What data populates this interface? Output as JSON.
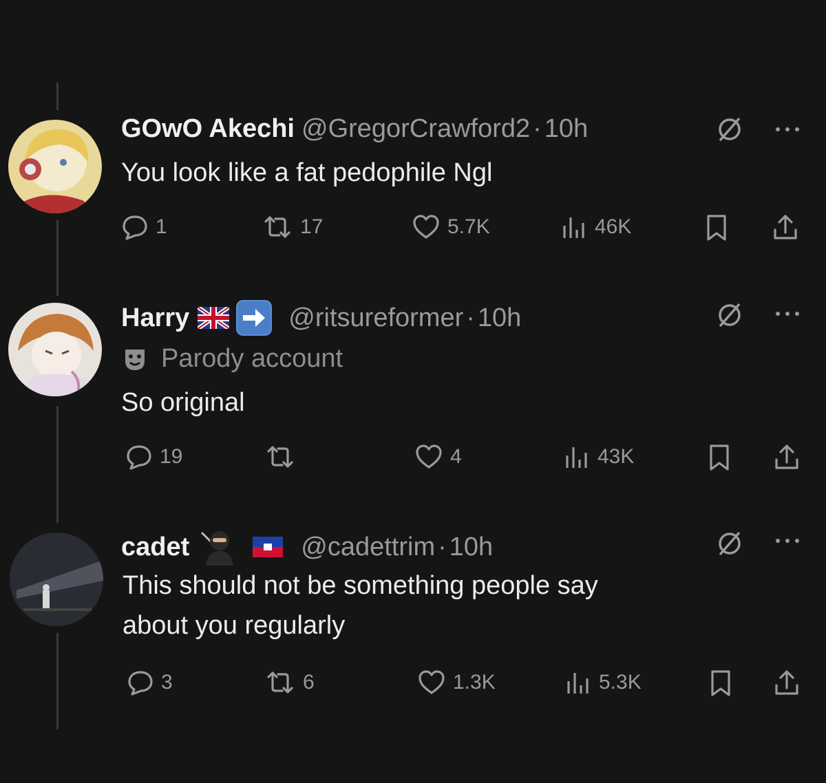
{
  "tweets": [
    {
      "name": "GOwO Akechi",
      "handle": "@GregorCrawford2",
      "time": "10h",
      "text_lines": [
        "You look like a fat pedophile Ngl"
      ],
      "replies": "1",
      "retweets": "17",
      "likes": "5.7K",
      "views": "46K"
    },
    {
      "name": "Harry",
      "handle": "@ritsureformer",
      "time": "10h",
      "parody_label": "Parody account",
      "text_lines": [
        "So original"
      ],
      "replies": "19",
      "retweets": "",
      "likes": "4",
      "views": "43K"
    },
    {
      "name": "cadet",
      "handle": "@cadettrim",
      "time": "10h",
      "text_lines": [
        "This should not be something people say",
        "about you regularly"
      ],
      "replies": "3",
      "retweets": "6",
      "likes": "1.3K",
      "views": "5.3K"
    }
  ],
  "separator": "·",
  "icons": {
    "reply": "comment-icon",
    "retweet": "retweet-icon",
    "like": "heart-icon",
    "views": "views-chart-icon",
    "bookmark": "bookmark-icon",
    "share": "share-icon",
    "grok": "grok-icon",
    "more": "more-dots-icon"
  },
  "colors": {
    "background": "#151515",
    "text": "#ececec",
    "muted": "#9a9a9a"
  }
}
